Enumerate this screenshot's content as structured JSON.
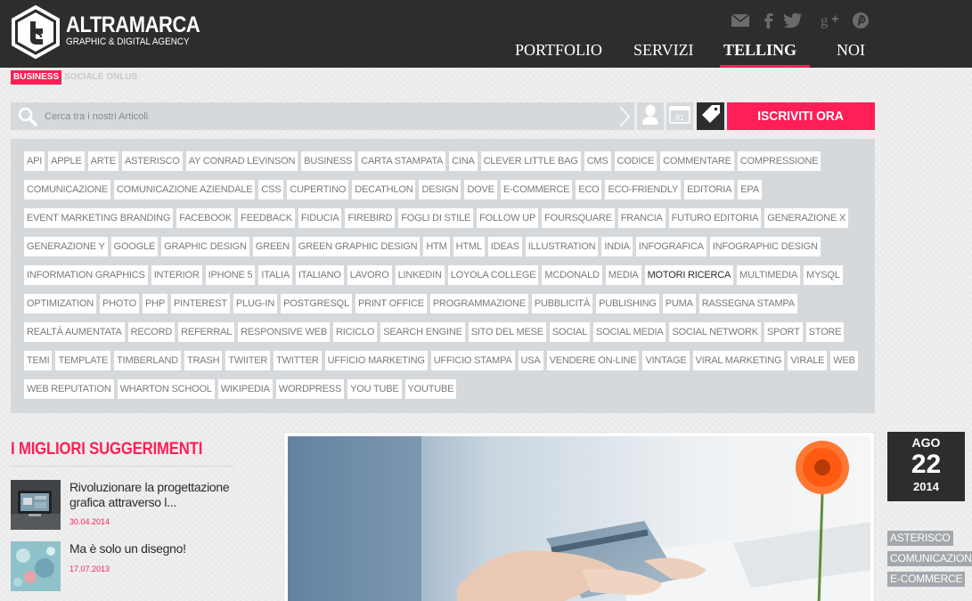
{
  "brand": {
    "name": "ALTRAMARCA",
    "tagline": "GRAPHIC & DIGITAL AGENCY",
    "accent_color": "#ff1e56",
    "header_color": "#2d2d2d"
  },
  "social_icons": [
    "mail-icon",
    "facebook-icon",
    "twitter-icon",
    "google-plus-icon",
    "pinterest-icon"
  ],
  "nav": {
    "items": [
      {
        "label": "PORTFOLIO",
        "active": false
      },
      {
        "label": "SERVIZI",
        "active": false
      },
      {
        "label": "TELLING",
        "active": true
      },
      {
        "label": "NOI",
        "active": false
      }
    ]
  },
  "subcategories": [
    {
      "label": "BUSINESS",
      "active": true
    },
    {
      "label": "SOCIALE ONLUS",
      "active": false
    }
  ],
  "search": {
    "placeholder": "Cerca tra i nostri Articoli",
    "calendar_day": "01",
    "subscribe_label": "ISCRIVITI ORA"
  },
  "tags": [
    "API",
    "APPLE",
    "ARTE",
    "ASTERISCO",
    "AY CONRAD LEVINSON",
    "BUSINESS",
    "CARTA STAMPATA",
    "CINA",
    "CLEVER LITTLE BAG",
    "CMS",
    "CODICE",
    "COMMENTARE",
    "COMPRESSIONE",
    "COMUNICAZIONE",
    "COMUNICAZIONE AZIENDALE",
    "CSS",
    "CUPERTINO",
    "DECATHLON",
    "DESIGN",
    "DOVE",
    "E-COMMERCE",
    "ECO",
    "ECO-FRIENDLY",
    "EDITORIA",
    "EPA",
    "EVENT MARKETING BRANDING",
    "FACEBOOK",
    "FEEDBACK",
    "FIDUCIA",
    "FIREBIRD",
    "FOGLI DI STILE",
    "FOLLOW UP",
    "FOURSQUARE",
    "FRANCIA",
    "FUTURO EDITORIA",
    "GENERAZIONE X",
    "GENERAZIONE Y",
    "GOOGLE",
    "GRAPHIC DESIGN",
    "GREEN",
    "GREEN GRAPHIC DESIGN",
    "HTM",
    "HTML",
    "IDEAS",
    "ILLUSTRATION",
    "INDIA",
    "INFOGRAFICA",
    "INFOGRAPHIC DESIGN",
    "INFORMATION GRAPHICS",
    "INTERIOR",
    "IPHONE 5",
    "ITALIA",
    "ITALIANO",
    "LAVORO",
    "LINKEDIN",
    "LOYOLA COLLEGE",
    "MCDONALD",
    "MEDIA",
    "MOTORI RICERCA",
    "MULTIMEDIA",
    "MYSQL",
    "OPTIMIZATION",
    "PHOTO",
    "PHP",
    "PINTEREST",
    "PLUG-IN",
    "POSTGRESQL",
    "PRINT OFFICE",
    "PROGRAMMAZIONE",
    "PUBBLICITÀ",
    "PUBLISHING",
    "PUMA",
    "RASSEGNA STAMPA",
    "REALTÀ AUMENTATA",
    "RECORD",
    "REFERRAL",
    "RESPONSIVE WEB",
    "RICICLO",
    "SEARCH ENGINE",
    "SITO DEL MESE",
    "SOCIAL",
    "SOCIAL MEDIA",
    "SOCIAL NETWORK",
    "SPORT",
    "STORE",
    "TEMI",
    "TEMPLATE",
    "TIMBERLAND",
    "TRASH",
    "TWIITER",
    "TWITTER",
    "UFFICIO MARKETING",
    "UFFICIO STAMPA",
    "USA",
    "VENDERE ON-LINE",
    "VINTAGE",
    "VIRAL MARKETING",
    "VIRALE",
    "WEB",
    "WEB REPUTATION",
    "WHARTON SCHOOL",
    "WIKIPEDIA",
    "WORDPRESS",
    "YOU TUBE",
    "YOUTUBE"
  ],
  "highlighted_tag": "MOTORI RICERCA",
  "sidebar": {
    "title": "I MIGLIORI SUGGERIMENTI",
    "items": [
      {
        "title": "Rivoluzionare la progettazione grafica attraverso l...",
        "date": "30.04.2014"
      },
      {
        "title": "Ma è solo un disegno!",
        "date": "17.07.2013"
      }
    ]
  },
  "post": {
    "date": {
      "month": "AGO",
      "day": "22",
      "year": "2014"
    },
    "tags": [
      "ASTERISCO",
      "COMUNICAZIONE",
      "E-COMMERCE"
    ]
  }
}
